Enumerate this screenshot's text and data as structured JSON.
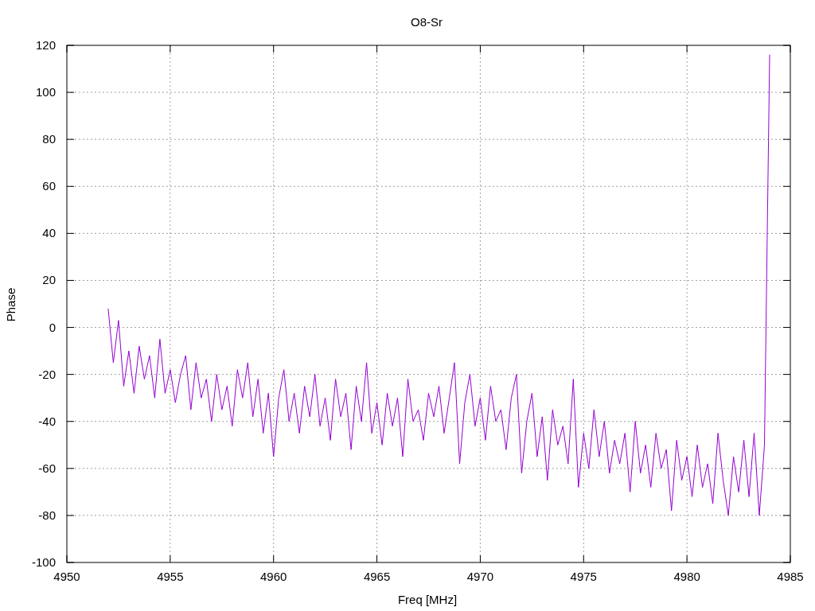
{
  "chart_data": {
    "type": "line",
    "title": "O8-Sr",
    "xlabel": "Freq [MHz]",
    "ylabel": "Phase",
    "grid": true,
    "xlim": [
      4950,
      4985
    ],
    "ylim": [
      -100,
      120
    ],
    "xticks": [
      4950,
      4955,
      4960,
      4965,
      4970,
      4975,
      4980,
      4985
    ],
    "yticks": [
      -100,
      -80,
      -60,
      -40,
      -20,
      0,
      20,
      40,
      60,
      80,
      100,
      120
    ],
    "x": [
      4952,
      4952.25,
      4952.5,
      4952.75,
      4953,
      4953.25,
      4953.5,
      4953.75,
      4954,
      4954.25,
      4954.5,
      4954.75,
      4955,
      4955.25,
      4955.5,
      4955.75,
      4956,
      4956.25,
      4956.5,
      4956.75,
      4957,
      4957.25,
      4957.5,
      4957.75,
      4958,
      4958.25,
      4958.5,
      4958.75,
      4959,
      4959.25,
      4959.5,
      4959.75,
      4960,
      4960.25,
      4960.5,
      4960.75,
      4961,
      4961.25,
      4961.5,
      4961.75,
      4962,
      4962.25,
      4962.5,
      4962.75,
      4963,
      4963.25,
      4963.5,
      4963.75,
      4964,
      4964.25,
      4964.5,
      4964.75,
      4965,
      4965.25,
      4965.5,
      4965.75,
      4966,
      4966.25,
      4966.5,
      4966.75,
      4967,
      4967.25,
      4967.5,
      4967.75,
      4968,
      4968.25,
      4968.5,
      4968.75,
      4969,
      4969.25,
      4969.5,
      4969.75,
      4970,
      4970.25,
      4970.5,
      4970.75,
      4971,
      4971.25,
      4971.5,
      4971.75,
      4972,
      4972.25,
      4972.5,
      4972.75,
      4973,
      4973.25,
      4973.5,
      4973.75,
      4974,
      4974.25,
      4974.5,
      4974.75,
      4975,
      4975.25,
      4975.5,
      4975.75,
      4976,
      4976.25,
      4976.5,
      4976.75,
      4977,
      4977.25,
      4977.5,
      4977.75,
      4978,
      4978.25,
      4978.5,
      4978.75,
      4979,
      4979.25,
      4979.5,
      4979.75,
      4980,
      4980.25,
      4980.5,
      4980.75,
      4981,
      4981.25,
      4981.5,
      4981.75,
      4982,
      4982.25,
      4982.5,
      4982.75,
      4983,
      4983.25,
      4983.5,
      4983.75,
      4984
    ],
    "series": [
      {
        "color": "#9400d3",
        "values": [
          8,
          -15,
          3,
          -25,
          -10,
          -28,
          -8,
          -22,
          -12,
          -30,
          -5,
          -28,
          -18,
          -32,
          -20,
          -12,
          -35,
          -15,
          -30,
          -22,
          -40,
          -20,
          -35,
          -25,
          -42,
          -18,
          -30,
          -15,
          -38,
          -22,
          -45,
          -28,
          -55,
          -30,
          -18,
          -40,
          -28,
          -45,
          -25,
          -38,
          -20,
          -42,
          -30,
          -48,
          -22,
          -38,
          -28,
          -52,
          -25,
          -40,
          -15,
          -45,
          -32,
          -50,
          -28,
          -42,
          -30,
          -55,
          -22,
          -40,
          -35,
          -48,
          -28,
          -38,
          -25,
          -45,
          -30,
          -15,
          -58,
          -32,
          -20,
          -42,
          -30,
          -48,
          -25,
          -40,
          -35,
          -52,
          -30,
          -20,
          -62,
          -40,
          -28,
          -55,
          -38,
          -65,
          -35,
          -50,
          -42,
          -58,
          -22,
          -68,
          -45,
          -60,
          -35,
          -55,
          -40,
          -62,
          -48,
          -58,
          -45,
          -70,
          -40,
          -62,
          -50,
          -68,
          -45,
          -60,
          -52,
          -78,
          -48,
          -65,
          -55,
          -72,
          -50,
          -68,
          -58,
          -75,
          -45,
          -65,
          -80,
          -55,
          -70,
          -48,
          -72,
          -45,
          -80,
          -50,
          116
        ]
      }
    ]
  }
}
